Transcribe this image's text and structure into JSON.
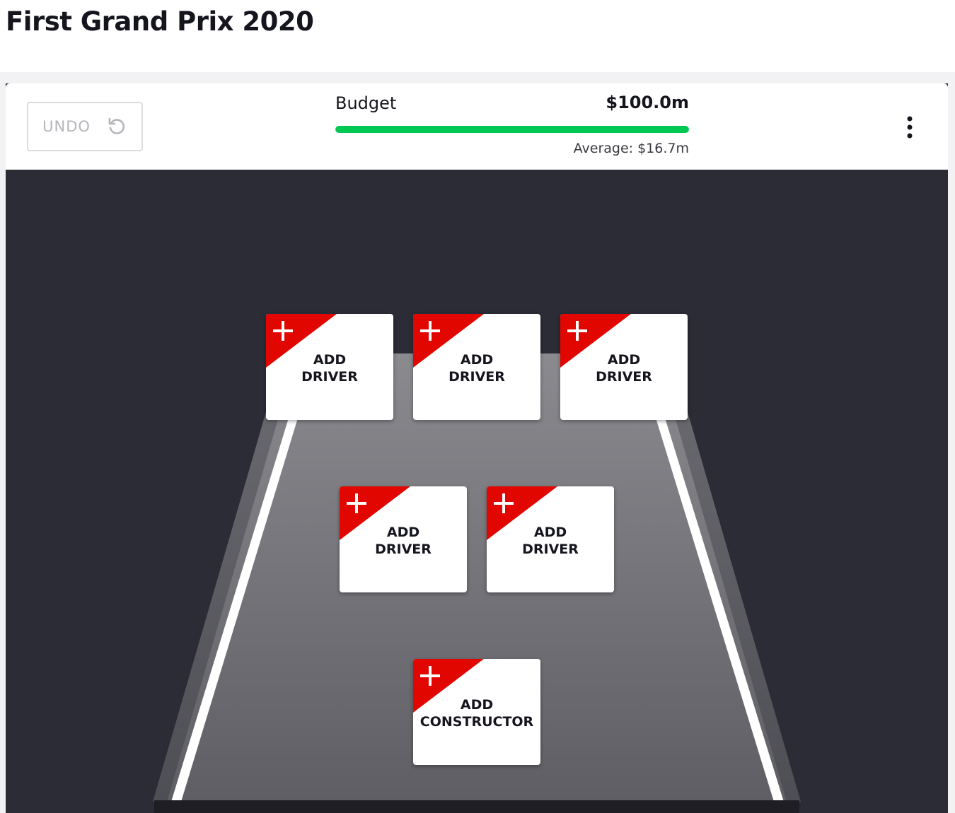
{
  "page": {
    "title": "First Grand Prix 2020"
  },
  "toolbar": {
    "undo_label": "UNDO",
    "budget_label": "Budget",
    "budget_value": "$100.0m",
    "budget_remaining_fraction": 1.0,
    "average_label": "Average: $16.7m",
    "more_icon": "vertical-dots-icon",
    "undo_icon": "undo-arrow-icon"
  },
  "colors": {
    "accent_red": "#e10600",
    "budget_green": "#00c853",
    "track_background": "#2b2c35"
  },
  "slots": {
    "drivers": [
      {
        "line1": "ADD",
        "line2": "DRIVER"
      },
      {
        "line1": "ADD",
        "line2": "DRIVER"
      },
      {
        "line1": "ADD",
        "line2": "DRIVER"
      },
      {
        "line1": "ADD",
        "line2": "DRIVER"
      },
      {
        "line1": "ADD",
        "line2": "DRIVER"
      }
    ],
    "constructor": {
      "line1": "ADD",
      "line2": "CONSTRUCTOR"
    },
    "icon": "plus-icon"
  }
}
